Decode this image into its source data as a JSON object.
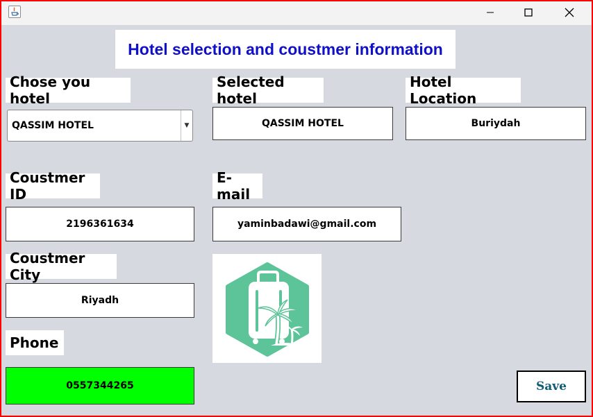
{
  "window": {
    "controls": {
      "minimize": "—",
      "maximize": "☐",
      "close": "✕"
    }
  },
  "header": {
    "title": "Hotel selection and coustmer information"
  },
  "hotel": {
    "chose_label": "Chose you hotel",
    "combo_value": "QASSIM HOTEL",
    "selected_label": "Selected hotel",
    "selected_value": "QASSIM HOTEL",
    "location_label": "Hotel Location",
    "location_value": "Buriydah"
  },
  "customer": {
    "id_label": "Coustmer ID",
    "id_value": "2196361634",
    "email_label": "E-mail",
    "email_value": "yaminbadawi@gmail.com",
    "city_label": "Coustmer City",
    "city_value": "Riyadh",
    "phone_label": "Phone",
    "phone_value": "0557344265"
  },
  "actions": {
    "save_label": "Save"
  },
  "colors": {
    "title_blue": "#1010c8",
    "phone_field_bg": "#00ff00",
    "logo_green": "#5cc498",
    "window_border": "#ff0000",
    "save_text": "#0e5c75"
  }
}
